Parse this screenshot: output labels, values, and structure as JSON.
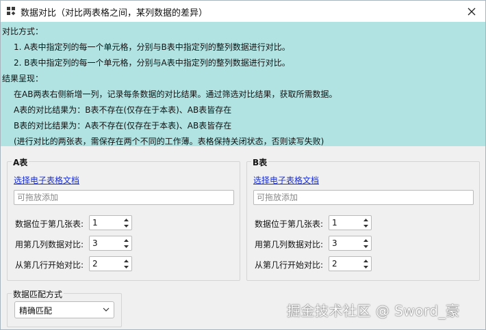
{
  "window": {
    "title": "数据对比（对比两表格之间，某列数据的差异）"
  },
  "description": {
    "compare_heading": "对比方式：",
    "compare_line1": "1. A表中指定列的每一个单元格，分别与B表中指定列的整列数据进行对比。",
    "compare_line2": "2. B表中指定列的每一个单元格，分别与A表中指定列的整列数据进行对比。",
    "result_heading": "结果呈现：",
    "result_line1": "在AB两表右侧新增一列，记录每条数据的对比结果。通过筛选对比结果，获取所需数据。",
    "result_line2": "A表的对比结果为：B表不存在(仅存在于本表)、AB表皆存在",
    "result_line3": "B表的对比结果为：A表不存在(仅存在于本表)、AB表皆存在",
    "result_line4": "(进行对比的两张表，需保存在两个不同的工作薄。表格保持关闭状态，否则读写失败)"
  },
  "table_a": {
    "group_title": "A表",
    "select_link": "选择电子表格文档",
    "drop_placeholder": "可拖放添加",
    "sheet_label": "数据位于第几张表:",
    "sheet_value": "1",
    "column_label": "用第几列数据对比:",
    "column_value": "3",
    "row_label": "从第几行开始对比:",
    "row_value": "2"
  },
  "table_b": {
    "group_title": "B表",
    "select_link": "选择电子表格文档",
    "drop_placeholder": "可拖放添加",
    "sheet_label": "数据位于第几张表:",
    "sheet_value": "1",
    "column_label": "用第几列数据对比:",
    "column_value": "3",
    "row_label": "从第几行开始对比:",
    "row_value": "2"
  },
  "match": {
    "group_title": "数据匹配方式",
    "selected": "精确匹配"
  },
  "watermark": "掘金技术社区 @ Sword_豪"
}
